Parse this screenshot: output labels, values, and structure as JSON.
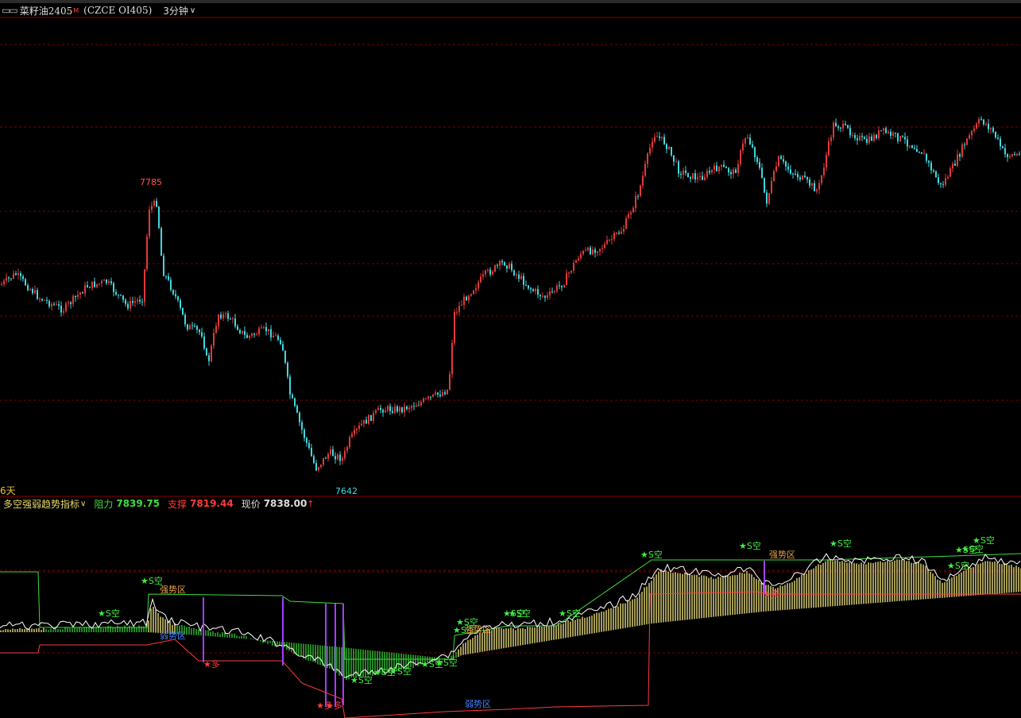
{
  "header": {
    "icon": "chart-tab-icon",
    "symbol": "菜籽油2405",
    "main_mark": "M",
    "code": "(CZCE OI405)",
    "period": "3分钟"
  },
  "main_chart": {
    "high_label": "7785",
    "low_label": "7642",
    "days_label": "6天"
  },
  "indicator": {
    "name": "多空强弱趋势指标",
    "resist_label": "阻力",
    "resist_value": "7839.75",
    "support_label": "支撑",
    "support_value": "7819.44",
    "price_label": "现价",
    "price_value": "7838.00",
    "price_arrow": "↑"
  },
  "annotations": {
    "strong_zone": "强势区",
    "weak_zone": "弱势区",
    "short_signal": "★S空",
    "long_signal": "多"
  },
  "colors": {
    "up": "#e03a3a",
    "down": "#3fd8e0",
    "grid": "#7a0000",
    "resist": "#3ddc3d",
    "support": "#ff3b3b",
    "strong_bar": "#e8dc7a",
    "weak_bar": "#30c030",
    "white_line": "#ffffff",
    "signal_purple": "#a040ff"
  }
}
